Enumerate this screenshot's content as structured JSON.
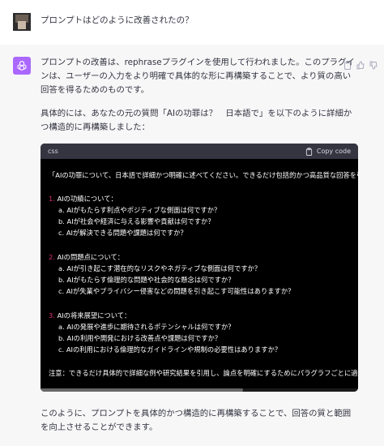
{
  "user": {
    "question": "プロンプトはどのように改善されたの？"
  },
  "assistant": {
    "intro": "プロンプトの改善は、rephraseプラグインを使用して行われました。このプラグインは、ユーザーの入力をより明確で具体的な形に再構築することで、より質の高い回答を得るためのものです。",
    "detail": "具体的には、あなたの元の質問「AIの功罪は？　日本語で」を以下のように詳細かつ構造的に再構築しました：",
    "conclusion": "このように、プロンプトを具体的かつ構造的に再構築することで、回答の質と範囲を向上させることができます。"
  },
  "code": {
    "language": "css",
    "copy_label": "Copy code",
    "intro_line": "「AIの功罪について、日本語で詳細かつ明確に述べてください。できるだけ包括的かつ高品質な回答を引き出",
    "sections": [
      {
        "num": "1.",
        "title": "AIの功績について：",
        "items": [
          "a. AIがもたらす利点やポジティブな側面は何ですか？",
          "b. AIが社会や経済に与える影響や貢献は何ですか？",
          "c. AIが解決できる問題や課題は何ですか？"
        ]
      },
      {
        "num": "2.",
        "title": "AIの問題点について：",
        "items": [
          "a. AIが引き起こす潜在的なリスクやネガティブな側面は何ですか？",
          "b. AIがもたらす倫理的な問題や社会的な懸念は何ですか？",
          "c. AIが失業やプライバシー侵害などの問題を引き起こす可能性はありますか？"
        ]
      },
      {
        "num": "3.",
        "title": "AIの将来展望について：",
        "items": [
          "a. AIの発展や進歩に期待されるポテンシャルは何ですか？",
          "b. AIの利用や開発における改善点や課題は何ですか？",
          "c. AIの利用における倫理的なガイドラインや規制の必要性はありますか？"
        ]
      }
    ],
    "note": "注意：できるだけ具体的で詳細な例や研究結果を引用し、論点を明確にするためにパラグラフごとに適切なタ"
  },
  "icons": {
    "avatar": "openai-logo-icon",
    "copy": "clipboard-icon",
    "actions": [
      "clipboard-icon",
      "thumbs-up-icon",
      "thumbs-down-icon"
    ]
  },
  "colors": {
    "avatar_bg": "#ab68ff",
    "number_accent": "#df3079",
    "code_bg": "#000000",
    "code_header_bg": "#343541"
  }
}
